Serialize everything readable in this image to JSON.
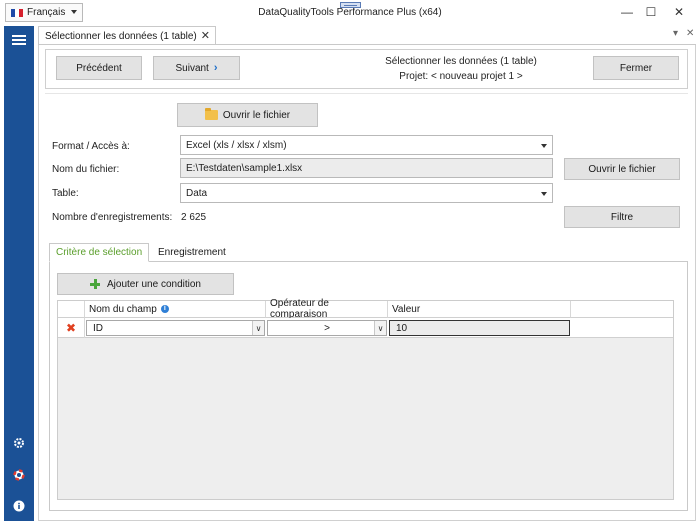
{
  "window": {
    "title": "DataQualityTools Performance Plus (x64)",
    "language": "Français",
    "minimize": "—",
    "maximize": "☐",
    "close": "✕"
  },
  "tab": {
    "label": "Sélectionner les données (1 table)",
    "close": "✕",
    "strip_dropdown": "▾",
    "strip_close": "✕"
  },
  "nav": {
    "previous": "Précédent",
    "next": "Suivant",
    "chevron": "›",
    "title": "Sélectionner les données (1 table)",
    "project": "Projet: < nouveau projet 1 >",
    "close": "Fermer"
  },
  "form": {
    "open_file_top": "Ouvrir le fichier",
    "format_label": "Format / Accès à:",
    "format_value": "Excel (xls / xlsx / xlsm)",
    "filename_label": "Nom du fichier:",
    "filename_value": "E:\\Testdaten\\sample1.xlsx",
    "open_file_right": "Ouvrir le fichier",
    "table_label": "Table:",
    "table_value": "Data",
    "records_label": "Nombre d'enregistrements:",
    "records_value": "2 625",
    "filter": "Filtre"
  },
  "subtabs": {
    "criteria": "Critère de sélection",
    "save": "Enregistrement"
  },
  "criteria": {
    "add_condition": "Ajouter une condition",
    "columns": {
      "field": "Nom du champ",
      "info": "i",
      "operator": "Opérateur de comparaison",
      "value": "Valeur"
    },
    "row": {
      "delete": "✖",
      "field": "ID",
      "operator": ">",
      "value": "10",
      "dropdown": "∨"
    }
  },
  "colors": {
    "sidebar": "#1b5196",
    "active_tab": "#5a9e2b",
    "accent": "#1d6ec8"
  },
  "icons": [
    "hamburger-icon",
    "gear-icon",
    "lifebuoy-icon",
    "info-icon",
    "folder-icon",
    "plus-icon",
    "delete-icon"
  ]
}
